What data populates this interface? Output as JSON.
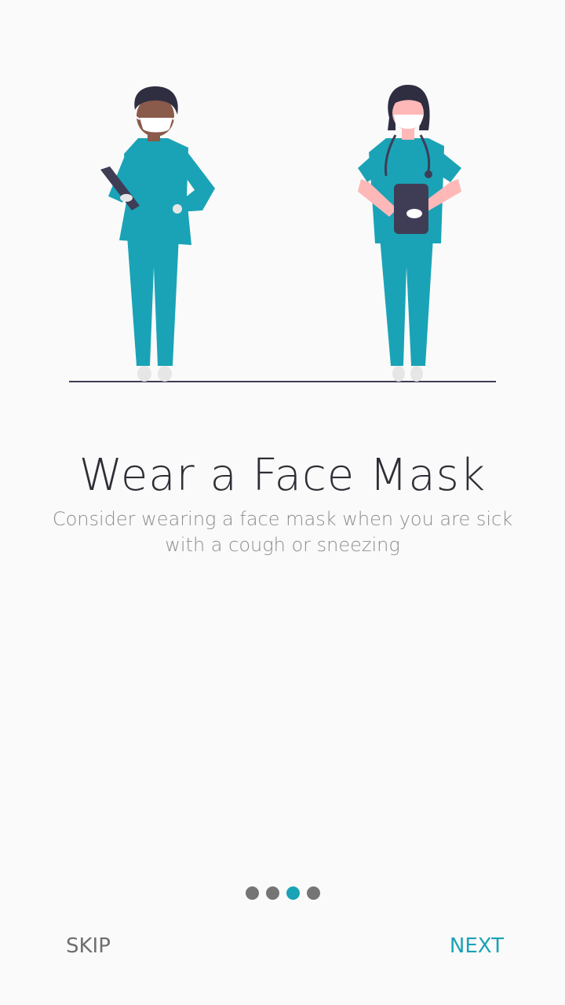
{
  "onboarding": {
    "title": "Wear a Face Mask",
    "subtitle": "Consider wearing a face mask when you are sick with a cough or sneezing",
    "pages": 4,
    "current_page": 3,
    "skip_label": "SKIP",
    "next_label": "NEXT"
  },
  "colors": {
    "accent": "#1aa3b6",
    "scrubs": "#1aa3b6",
    "indicator_inactive": "#757575",
    "title": "#2e2e36",
    "subtitle": "#8d8d8d",
    "background": "#fafafa"
  },
  "icons": {
    "illustration": "two-healthcare-workers-wearing-masks-illustration"
  }
}
